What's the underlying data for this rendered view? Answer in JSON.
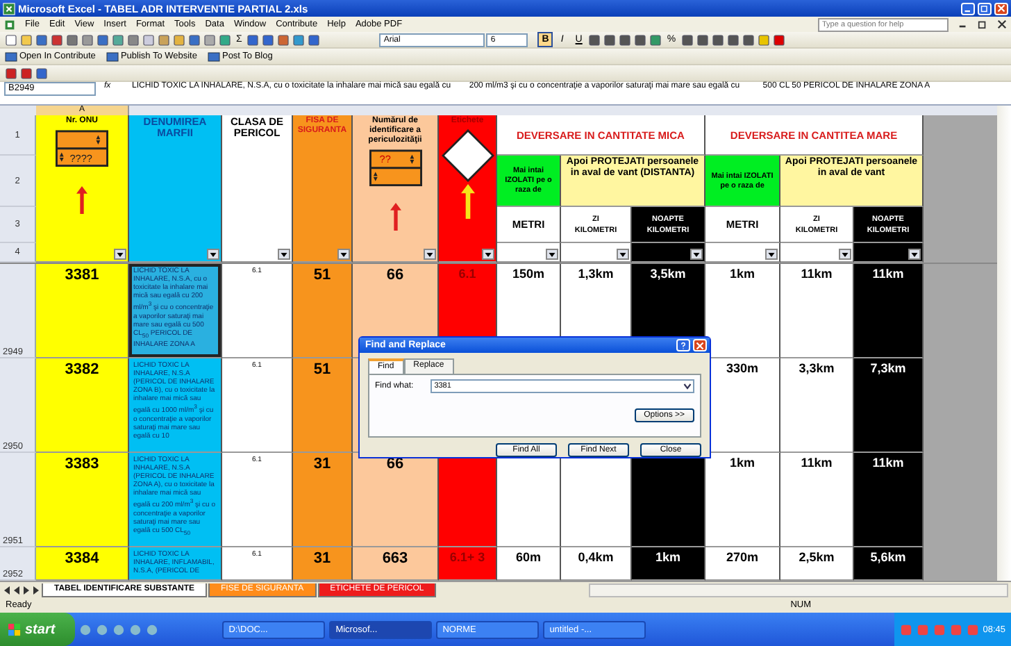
{
  "window": {
    "title": "Microsoft Excel - TABEL ADR INTERVENTIE PARTIAL 2.xls"
  },
  "menu": [
    "File",
    "Edit",
    "View",
    "Insert",
    "Format",
    "Tools",
    "Data",
    "Window",
    "Contribute",
    "Help",
    "Adobe PDF"
  ],
  "help_box": {
    "placeholder": "Type a question for help"
  },
  "toolbar": {
    "autosum": "Σ",
    "font": "Arial",
    "size": "6",
    "format_buttons": [
      {
        "label": "B",
        "selected": true
      },
      {
        "label": "I",
        "selected": false
      },
      {
        "label": "U",
        "selected": false
      }
    ],
    "percent": "%"
  },
  "contribute_toolbar": [
    "Open In Contribute",
    "Publish To Website",
    "Post To Blog"
  ],
  "formula_bar": {
    "name_box": "B2949",
    "fx": "fx",
    "value": "LICHID TOXIC LA INHALARE, N.S.A, cu o toxicitate la inhalare mai mică sau egală cu        200 ml/m3 şi cu o concentraţie a vaporilor saturaţi mai mare sau egală cu          500 CL 50 PERICOL DE INHALARE ZONA A"
  },
  "column_header": "A",
  "sheet": {
    "row_numbers": [
      "1",
      "2",
      "3",
      "4"
    ],
    "header": {
      "onu": "Nr. ONU",
      "plate_text": "????",
      "name": "DENUMIREA MARFII",
      "class": "CLASA DE PERICOL",
      "safety_sheet": "FISA DE SIGURANTA",
      "hazard_id": "Numărul de identificare a periculozităţii",
      "hazard_plate_text": "??",
      "label": "Etichete",
      "small": {
        "title": "DEVERSARE IN CANTITATE MICA",
        "isolate": "Mai intai IZOLATI pe o raza de",
        "protect": "Apoi  PROTEJATI persoanele in aval de vant (DISTANTA)",
        "metri": "METRI",
        "day": "ZI",
        "day_unit": "KILOMETRI",
        "night": "NOAPTE",
        "night_unit": "KILOMETRI"
      },
      "large": {
        "title": "DEVERSARE IN CANTITEA  MARE",
        "isolate": "Mai intai IZOLATI pe o raza de",
        "protect": "Apoi  PROTEJATI persoanele in aval de vant",
        "metri": "METRI",
        "day": "ZI",
        "day_unit": "KILOMETRI",
        "night": "NOAPTE",
        "night_unit": "KILOMETRI"
      }
    },
    "rows": [
      {
        "row_number": "2949",
        "selected": true,
        "onu": "3381",
        "name": "LICHID TOXIC LA INHALARE, N.S.A, cu o toxicitate la inhalare mai mică sau egală cu 200 ml/m$^{3}$ şi cu o concentraţie a vaporilor saturaţi mai mare sau egală cu 500 CL$_{50}$ PERICOL DE INHALARE ZONA A",
        "class": "6.1",
        "safety_sheet": "51",
        "hazard_id": "66",
        "label": "6.1",
        "small_isolate": "150m",
        "small_day": "1,3km",
        "small_night": "3,5km",
        "large_isolate": "1km",
        "large_day": "11km",
        "large_night": "11km"
      },
      {
        "row_number": "2950",
        "selected": false,
        "onu": "3382",
        "name": "LICHID TOXIC LA INHALARE, N.S.A (PERICOL DE INHALARE ZONA B), cu o toxicitate la inhalare mai mică sau egală cu 1000 ml/m$^{3}$ şi cu o concentraţie a vaporilor saturaţi mai mare sau egală cu 10",
        "class": "6.1",
        "safety_sheet": "51",
        "hazard_id": null,
        "label": null,
        "small_isolate": null,
        "small_day": null,
        "small_night": null,
        "large_isolate": "330m",
        "large_day": "3,3km",
        "large_night": "7,3km"
      },
      {
        "row_number": "2951",
        "selected": false,
        "onu": "3383",
        "name": "LICHID TOXIC LA INHALARE, N.S.A (PERICOL DE INHALARE ZONA A), cu o toxicitate la inhalare mai mică sau egală cu 200 ml/m$^{3}$ şi cu o concentraţie a vaporilor saturaţi mai mare sau egală cu 500 CL$_{50}$",
        "class": "6.1",
        "safety_sheet": "31",
        "hazard_id": "66",
        "label": null,
        "small_isolate": null,
        "small_day": null,
        "small_night": null,
        "large_isolate": "1km",
        "large_day": "11km",
        "large_night": "11km"
      },
      {
        "row_number": "2952",
        "selected": false,
        "onu": "3384",
        "name": "LICHID TOXIC LA INHALARE, INFLAMABIL, N.S.A, (PERICOL DE",
        "class": "6.1",
        "safety_sheet": "31",
        "hazard_id": "663",
        "label": "6.1+ 3",
        "small_isolate": "60m",
        "small_day": "0,4km",
        "small_night": "1km",
        "large_isolate": "270m",
        "large_day": "2,5km",
        "large_night": "5,6km"
      }
    ]
  },
  "sheet_tabs": [
    {
      "label": "TABEL  IDENTIFICARE SUBSTANTE",
      "selected": true,
      "color": "#ffffff"
    },
    {
      "label": "FISE DE SIGURANTA",
      "selected": false,
      "color": "#ff8c1a"
    },
    {
      "label": "ETICHETE DE PERICOL",
      "selected": false,
      "color": "#ee1c1c"
    }
  ],
  "status_bar": {
    "left": "Ready",
    "right": "NUM"
  },
  "dialog": {
    "title": "Find and Replace",
    "tabs": [
      {
        "label": "Find",
        "selected": true
      },
      {
        "label": "Replace",
        "selected": false
      }
    ],
    "find_label": "Find what:",
    "find_value": "3381",
    "options_button": "Options >>",
    "buttons": [
      "Find All",
      "Find Next",
      "Close"
    ]
  },
  "taskbar": {
    "start": "start",
    "items": [
      {
        "label": "D:\\DOC...",
        "selected": false
      },
      {
        "label": "Microsof...",
        "selected": true
      },
      {
        "label": "NORME",
        "selected": false
      },
      {
        "label": "untitled -...",
        "selected": false
      }
    ],
    "clock": "08:45"
  }
}
